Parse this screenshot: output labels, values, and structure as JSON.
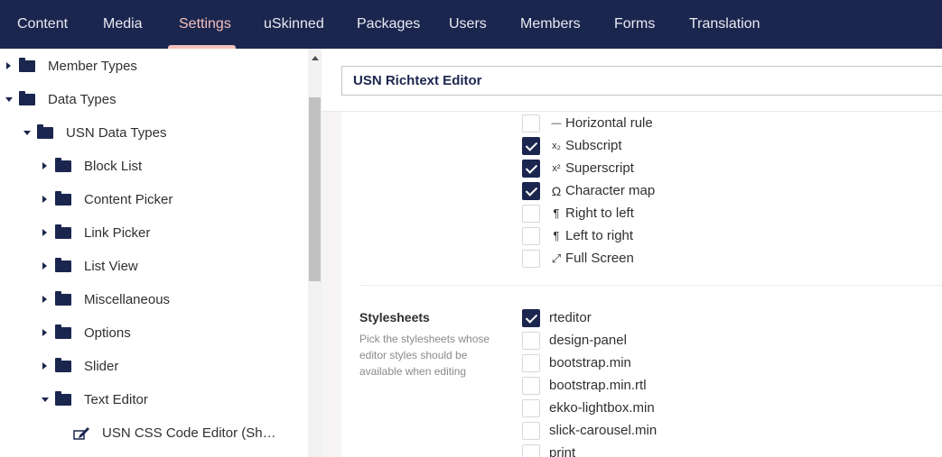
{
  "nav": {
    "items": [
      "Content",
      "Media",
      "Settings",
      "uSkinned",
      "Packages",
      "Users",
      "Members",
      "Forms",
      "Translation"
    ],
    "active": "Settings"
  },
  "tree": {
    "items": [
      {
        "label": "Member Types",
        "caret": "right"
      },
      {
        "label": "Data Types",
        "caret": "down"
      },
      {
        "label": "USN Data Types",
        "caret": "down"
      },
      {
        "label": "Block List",
        "caret": "right"
      },
      {
        "label": "Content Picker",
        "caret": "right"
      },
      {
        "label": "Link Picker",
        "caret": "right"
      },
      {
        "label": "List View",
        "caret": "right"
      },
      {
        "label": "Miscellaneous",
        "caret": "right"
      },
      {
        "label": "Options",
        "caret": "right"
      },
      {
        "label": "Slider",
        "caret": "right"
      },
      {
        "label": "Text Editor",
        "caret": "down"
      },
      {
        "label": "USN CSS Code Editor (Sh…",
        "caret": "none"
      }
    ]
  },
  "editor": {
    "name_value": "USN Richtext Editor"
  },
  "toolbar_options": [
    {
      "label": "Horizontal rule",
      "glyph": "—",
      "icon": "horizontal-rule-icon",
      "checked": false
    },
    {
      "label": "Subscript",
      "glyph": "x₂",
      "icon": "subscript-icon",
      "checked": true
    },
    {
      "label": "Superscript",
      "glyph": "x²",
      "icon": "superscript-icon",
      "checked": true
    },
    {
      "label": "Character map",
      "glyph": "Ω",
      "icon": "character-map-icon",
      "checked": true
    },
    {
      "label": "Right to left",
      "glyph": "¶",
      "icon": "right-to-left-icon",
      "checked": false
    },
    {
      "label": "Left to right",
      "glyph": "¶",
      "icon": "left-to-right-icon",
      "checked": false
    },
    {
      "label": "Full Screen",
      "glyph": "⤢",
      "icon": "full-screen-icon",
      "checked": false
    }
  ],
  "stylesheets": {
    "title": "Stylesheets",
    "description": "Pick the stylesheets whose editor styles should be available when editing",
    "items": [
      {
        "label": "rteditor",
        "checked": true
      },
      {
        "label": "design-panel",
        "checked": false
      },
      {
        "label": "bootstrap.min",
        "checked": false
      },
      {
        "label": "bootstrap.min.rtl",
        "checked": false
      },
      {
        "label": "ekko-lightbox.min",
        "checked": false
      },
      {
        "label": "slick-carousel.min",
        "checked": false
      },
      {
        "label": "print",
        "checked": false
      }
    ]
  },
  "colors": {
    "nav_bg": "#1b264f",
    "accent": "#f5c1bc",
    "checkbox_checked": "#1b264f"
  }
}
